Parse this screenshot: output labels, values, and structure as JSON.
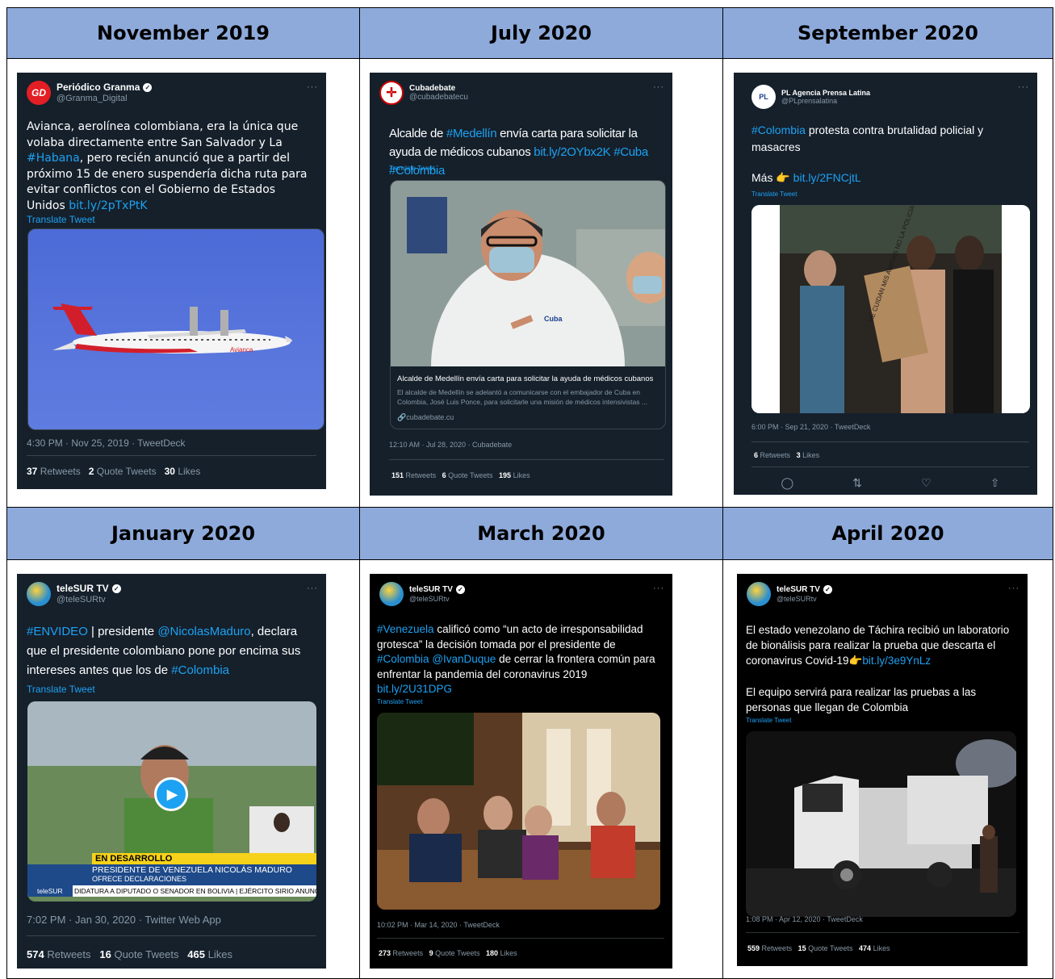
{
  "headers": [
    "November 2019",
    "July 2020",
    "September 2020",
    "January 2020",
    "March 2020",
    "April 2020"
  ],
  "tweets": [
    {
      "name": "Periódico Granma",
      "handle": "@Granma_Digital",
      "text_parts": [
        "Avianca, aerolínea colombiana, era la única que volaba directamente entre San Salvador y La ",
        "#Habana",
        ", pero recién anunció que a partir del próximo 15 de enero suspendería dicha ruta para evitar conflictos con el Gobierno de Estados Unidos ",
        "bit.ly/2pTxPtK"
      ],
      "translate": "Translate Tweet",
      "timestamp": "4:30 PM · Nov 25, 2019 · TweetDeck",
      "retweets": "37",
      "retweets_label": "Retweets",
      "quotes": "2",
      "quotes_label": "Quote Tweets",
      "likes": "30",
      "likes_label": "Likes",
      "plane_label": "Avianca"
    },
    {
      "name": "Cubadebate",
      "handle": "@cubadebatecu",
      "text_parts": [
        "Alcalde de ",
        "#Medellín",
        " envía carta para solicitar la ayuda de médicos cubanos ",
        "bit.ly/2OYbx2K",
        " ",
        "#Cuba",
        " ",
        "#Colombia"
      ],
      "translate": "Translate Tweet",
      "card_title": "Alcalde de Medellín envía carta para solicitar la ayuda de médicos cubanos",
      "card_desc": "El alcalde de Medellín se adelantó a comunicarse con el embajador de Cuba en Colombia, José Luis Ponce, para solicitarle una misión de médicos intensivistas ...",
      "card_domain": "cubadebate.cu",
      "coat_label": "Cuba",
      "timestamp": "12:10 AM · Jul 28, 2020 · Cubadebate",
      "retweets": "151",
      "retweets_label": "Retweets",
      "quotes": "6",
      "quotes_label": "Quote Tweets",
      "likes": "195",
      "likes_label": "Likes"
    },
    {
      "name": "PL Agencia Prensa Latina",
      "handle": "@PLprensalatina",
      "text_parts": [
        "#Colombia",
        " protesta contra brutalidad policial y masacres"
      ],
      "text2_prefix": "Más 👉 ",
      "text2_link": "bit.ly/2FNCjtL",
      "translate": "Translate Tweet",
      "sign_text": "ME CUIDAN MIS AMIGAS NO LA POLICÍA",
      "timestamp": "6:00 PM · Sep 21, 2020 · TweetDeck",
      "retweets": "6",
      "retweets_label": "Retweets",
      "likes": "3",
      "likes_label": "Likes"
    },
    {
      "name": "teleSUR TV",
      "handle": "@teleSURtv",
      "text_parts": [
        "#ENVIDEO",
        " | presidente ",
        "@NicolasMaduro",
        ", declara que el presidente colombiano pone por encima sus intereses antes que los de ",
        "#Colombia"
      ],
      "translate": "Translate Tweet",
      "banner_top": "EN DESARROLLO",
      "banner_main": "PRESIDENTE DE VENEZUELA NICOLÁS MADURO",
      "banner_sub": "OFRECE DECLARACIONES",
      "ticker_brand": "teleSUR",
      "ticker_text": "DIDATURA A DIPUTADO O SENADOR EN BOLIVIA  |  EJÉRCITO SIRIO ANUNCIA L",
      "timestamp": "7:02 PM · Jan 30, 2020 · Twitter Web App",
      "retweets": "574",
      "retweets_label": "Retweets",
      "quotes": "16",
      "quotes_label": "Quote Tweets",
      "likes": "465",
      "likes_label": "Likes"
    },
    {
      "name": "teleSUR TV",
      "handle": "@teleSURtv",
      "text_parts": [
        "#Venezuela",
        " calificó como “un acto de irresponsabilidad grotesca” la decisión tomada por el presidente de ",
        "#Colombia",
        " ",
        "@IvanDuque",
        " de cerrar la frontera común para enfrentar la pandemia del coronavirus 2019 ",
        "bit.ly/2U31DPG"
      ],
      "translate": "Translate Tweet",
      "timestamp": "10:02 PM · Mar 14, 2020 · TweetDeck",
      "retweets": "273",
      "retweets_label": "Retweets",
      "quotes": "9",
      "quotes_label": "Quote Tweets",
      "likes": "180",
      "likes_label": "Likes"
    },
    {
      "name": "teleSUR TV",
      "handle": "@teleSURtv",
      "text_parts": [
        "El estado venezolano de Táchira recibió un laboratorio de bionálisis para realizar la prueba que descarta el coronavirus Covid-19👉",
        "bit.ly/3e9YnLz"
      ],
      "text2": "El equipo servirá para realizar las pruebas a las personas que llegan de Colombia",
      "translate": "Translate Tweet",
      "timestamp": "1:08 PM · Apr 12, 2020 · TweetDeck",
      "retweets": "559",
      "retweets_label": "Retweets",
      "quotes": "15",
      "quotes_label": "Quote Tweets",
      "likes": "474",
      "likes_label": "Likes"
    }
  ],
  "icons": {
    "more": "···",
    "reply": "reply-icon",
    "retweet": "retweet-icon",
    "like": "like-icon",
    "share": "share-icon",
    "play": "play-icon",
    "verified": "verified-icon"
  },
  "colors": {
    "header_bg": "#8eaadb",
    "tweet_bg": "#15202b",
    "tweet_black": "#000000",
    "link": "#1da1f2",
    "muted": "#8899a6"
  }
}
